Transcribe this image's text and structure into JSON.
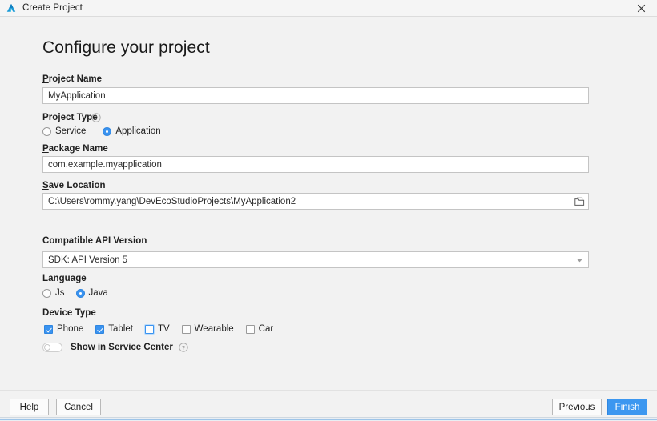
{
  "window": {
    "title": "Create Project",
    "logo_icon": "deveco-studio-logo",
    "close_icon": "close-icon"
  },
  "page": {
    "heading": "Configure your project"
  },
  "fields": {
    "project_name": {
      "label_mnemonic": "P",
      "label_rest": "roject Name",
      "value": "MyApplication"
    },
    "project_type": {
      "label": "Project Type",
      "help_icon": "help-icon",
      "options": [
        {
          "label": "Service",
          "selected": false
        },
        {
          "label": "Application",
          "selected": true
        }
      ]
    },
    "package_name": {
      "label_mnemonic": "P",
      "label_rest": "ackage Name",
      "value": "com.example.myapplication"
    },
    "save_location": {
      "label_mnemonic": "S",
      "label_rest": "ave Location",
      "value": "C:\\Users\\rommy.yang\\DevEcoStudioProjects\\MyApplication2",
      "browse_icon": "folder-icon"
    },
    "api_version": {
      "label": "Compatible API Version",
      "value": "SDK: API Version 5",
      "dropdown_icon": "chevron-down-icon"
    },
    "language": {
      "label": "Language",
      "options": [
        {
          "label": "Js",
          "selected": false
        },
        {
          "label": "Java",
          "selected": true
        }
      ]
    },
    "device_type": {
      "label": "Device Type",
      "options": [
        {
          "label": "Phone",
          "checked": true,
          "focused": false
        },
        {
          "label": "Tablet",
          "checked": true,
          "focused": false
        },
        {
          "label": "TV",
          "checked": false,
          "focused": true
        },
        {
          "label": "Wearable",
          "checked": false,
          "focused": false
        },
        {
          "label": "Car",
          "checked": false,
          "focused": false
        }
      ]
    },
    "service_center": {
      "label": "Show in Service Center",
      "enabled": false,
      "help_icon": "help-icon"
    }
  },
  "footer": {
    "help_label": "Help",
    "cancel_mnemonic": "C",
    "cancel_rest": "ancel",
    "previous_mnemonic": "P",
    "previous_rest": "revious",
    "finish_mnemonic": "F",
    "finish_rest": "inish"
  },
  "colors": {
    "accent": "#3c97f0",
    "background": "#f2f2f2",
    "field_background": "#ffffff",
    "field_border": "#c4c4c4",
    "text": "#1f1f1f"
  }
}
